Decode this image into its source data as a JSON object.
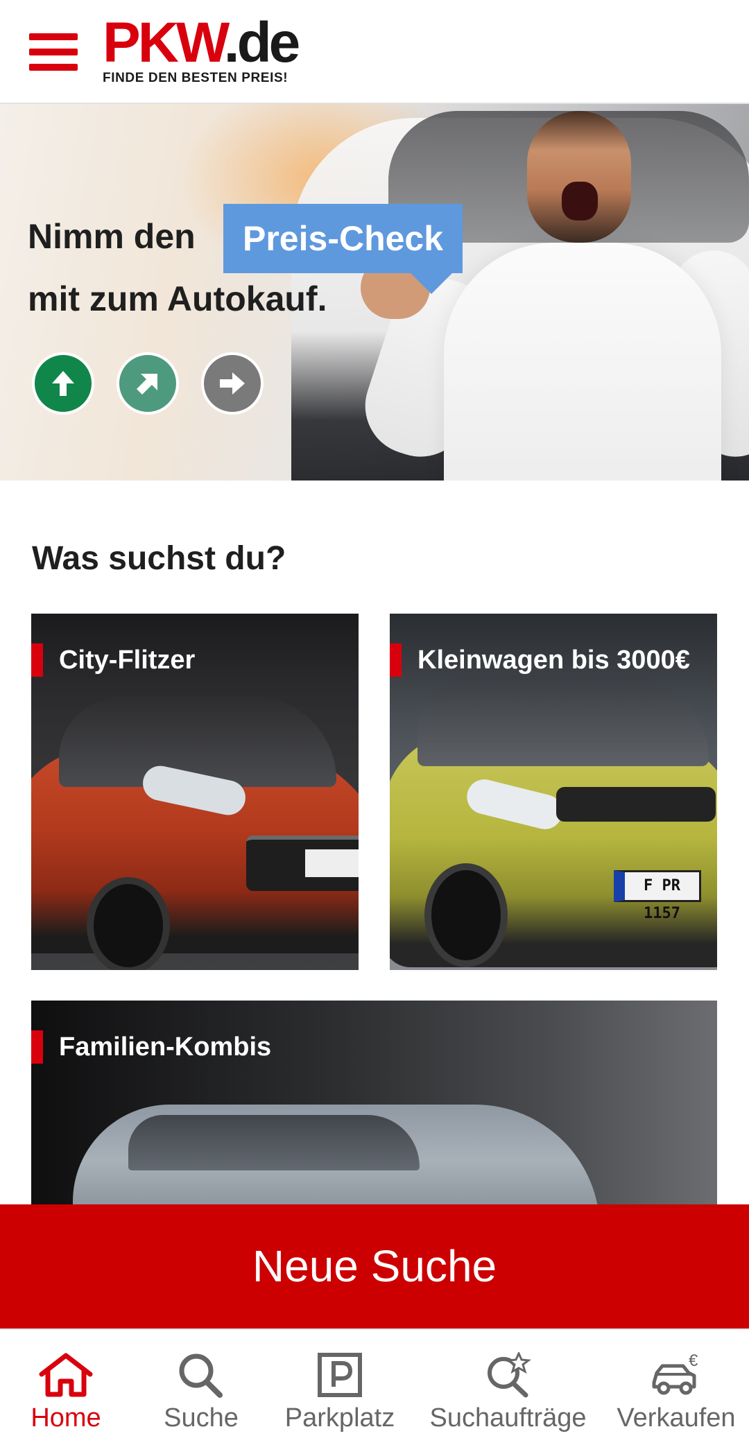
{
  "header": {
    "menu_icon": "hamburger-menu-icon",
    "logo_brand": "PKW",
    "logo_tld": ".de",
    "logo_tagline": "FINDE DEN BESTEN PREIS!",
    "brand_color": "#d9000d"
  },
  "hero": {
    "line1": "Nimm den",
    "badge": "Preis-Check",
    "line2": "mit zum Autokauf.",
    "badge_color": "#5f99dd",
    "price_indicators": [
      {
        "icon": "arrow-up-icon",
        "color": "#11864a"
      },
      {
        "icon": "arrow-up-right-icon",
        "color": "#4e9a7e"
      },
      {
        "icon": "arrow-right-icon",
        "color": "#7a7a7a"
      }
    ]
  },
  "section": {
    "title": "Was suchst du?"
  },
  "categories": [
    {
      "label": "City-Flitzer"
    },
    {
      "label": "Kleinwagen bis 3000€",
      "plate": "F PR 1157"
    },
    {
      "label": "Familien-Kombis"
    }
  ],
  "cta": {
    "label": "Neue Suche",
    "color": "#cc0000"
  },
  "bottom_nav": {
    "items": [
      {
        "label": "Home",
        "icon": "home-icon",
        "active": true
      },
      {
        "label": "Suche",
        "icon": "search-icon",
        "active": false
      },
      {
        "label": "Parkplatz",
        "icon": "parking-icon",
        "active": false
      },
      {
        "label": "Suchaufträge",
        "icon": "saved-search-star-icon",
        "active": false
      },
      {
        "label": "Verkaufen",
        "icon": "car-euro-icon",
        "active": false
      }
    ],
    "active_color": "#d9000d",
    "inactive_color": "#666666"
  }
}
